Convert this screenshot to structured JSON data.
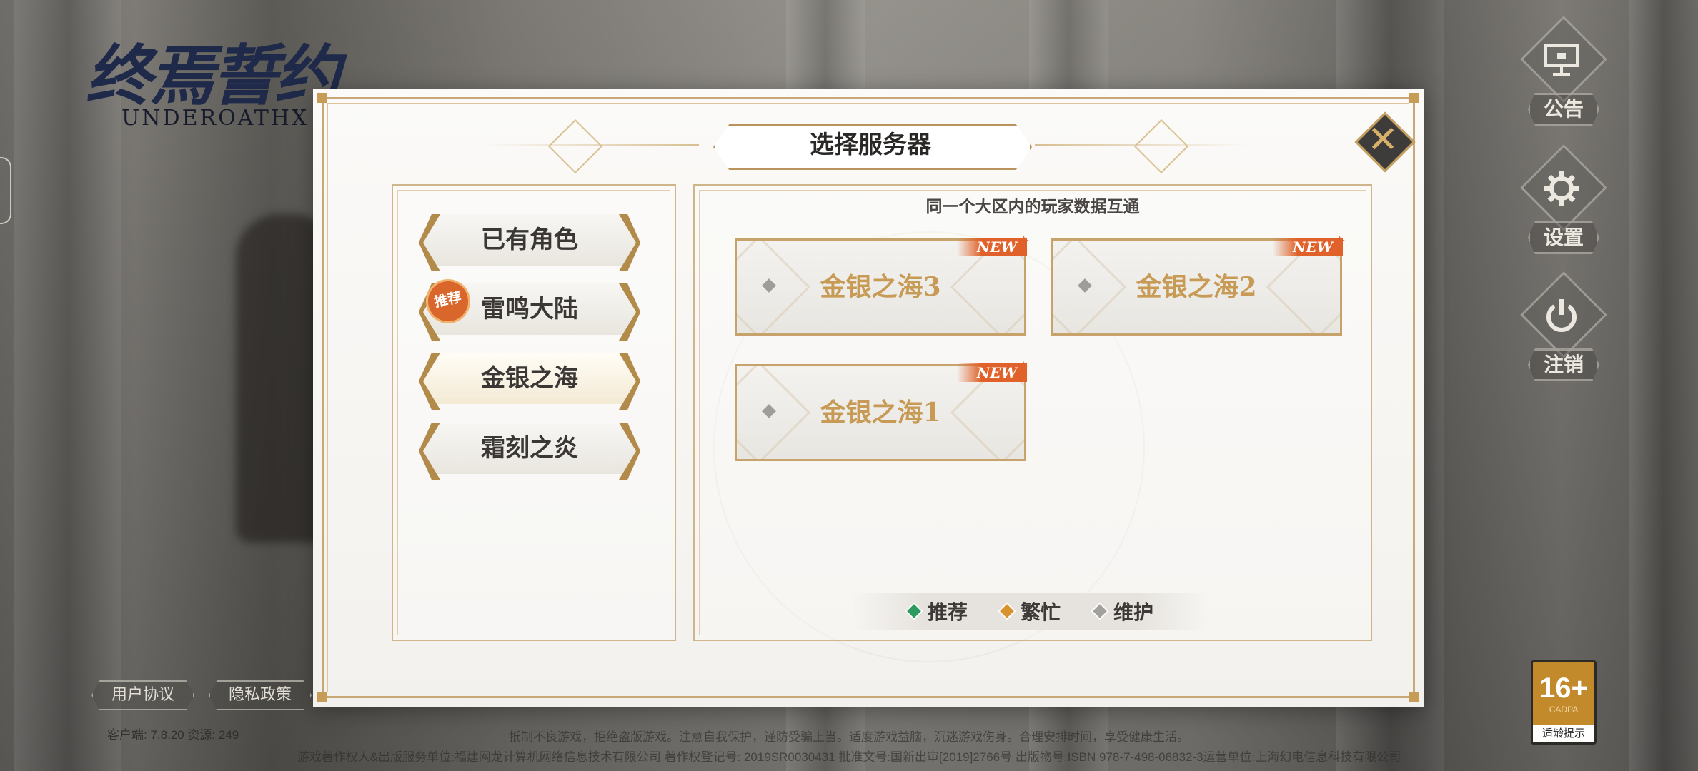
{
  "game": {
    "logo_cn": "终焉誓约",
    "logo_en": "UNDEROATHX"
  },
  "side_menu": [
    {
      "label": "公告",
      "icon": "easel-icon"
    },
    {
      "label": "设置",
      "icon": "gear-icon"
    },
    {
      "label": "注销",
      "icon": "power-icon"
    }
  ],
  "dialog": {
    "title": "选择服务器",
    "subtitle": "同一个大区内的玩家数据互通",
    "regions": [
      {
        "label": "已有角色",
        "selected": false
      },
      {
        "label": "雷鸣大陆",
        "selected": false,
        "badge": "推荐"
      },
      {
        "label": "金银之海",
        "selected": true
      },
      {
        "label": "霜刻之炎",
        "selected": false
      }
    ],
    "servers": [
      {
        "name": "金银之海3",
        "tag": "NEW"
      },
      {
        "name": "金银之海2",
        "tag": "NEW"
      },
      {
        "name": "金银之海1",
        "tag": "NEW"
      }
    ],
    "legend": [
      {
        "label": "推荐",
        "color": "#2f9a5e"
      },
      {
        "label": "繁忙",
        "color": "#d8922f"
      },
      {
        "label": "维护",
        "color": "#a3a19d"
      }
    ]
  },
  "footer": {
    "user_agreement": "用户协议",
    "privacy_policy": "隐私政策",
    "version": "客户端: 7.8.20  资源: 249",
    "notice_line1": "抵制不良游戏，拒绝盗版游戏。注意自我保护，谨防受骗上当。适度游戏益脑，沉迷游戏伤身。合理安排时间，享受健康生活。",
    "notice_line2": "游戏著作权人&出版服务单位:福建网龙计算机网络信息技术有限公司  著作权登记号: 2019SR0030431  批准文号:国新出审[2019]2766号  出版物号:ISBN 978-7-498-06832-3运营单位:上海幻电信息科技有限公司",
    "age_rating": "16+",
    "age_org": "CADPA",
    "age_tip": "适龄提示"
  },
  "colors": {
    "gold": "#c69c56",
    "accent_new": "#e0622a",
    "server_text": "#c79b55"
  }
}
